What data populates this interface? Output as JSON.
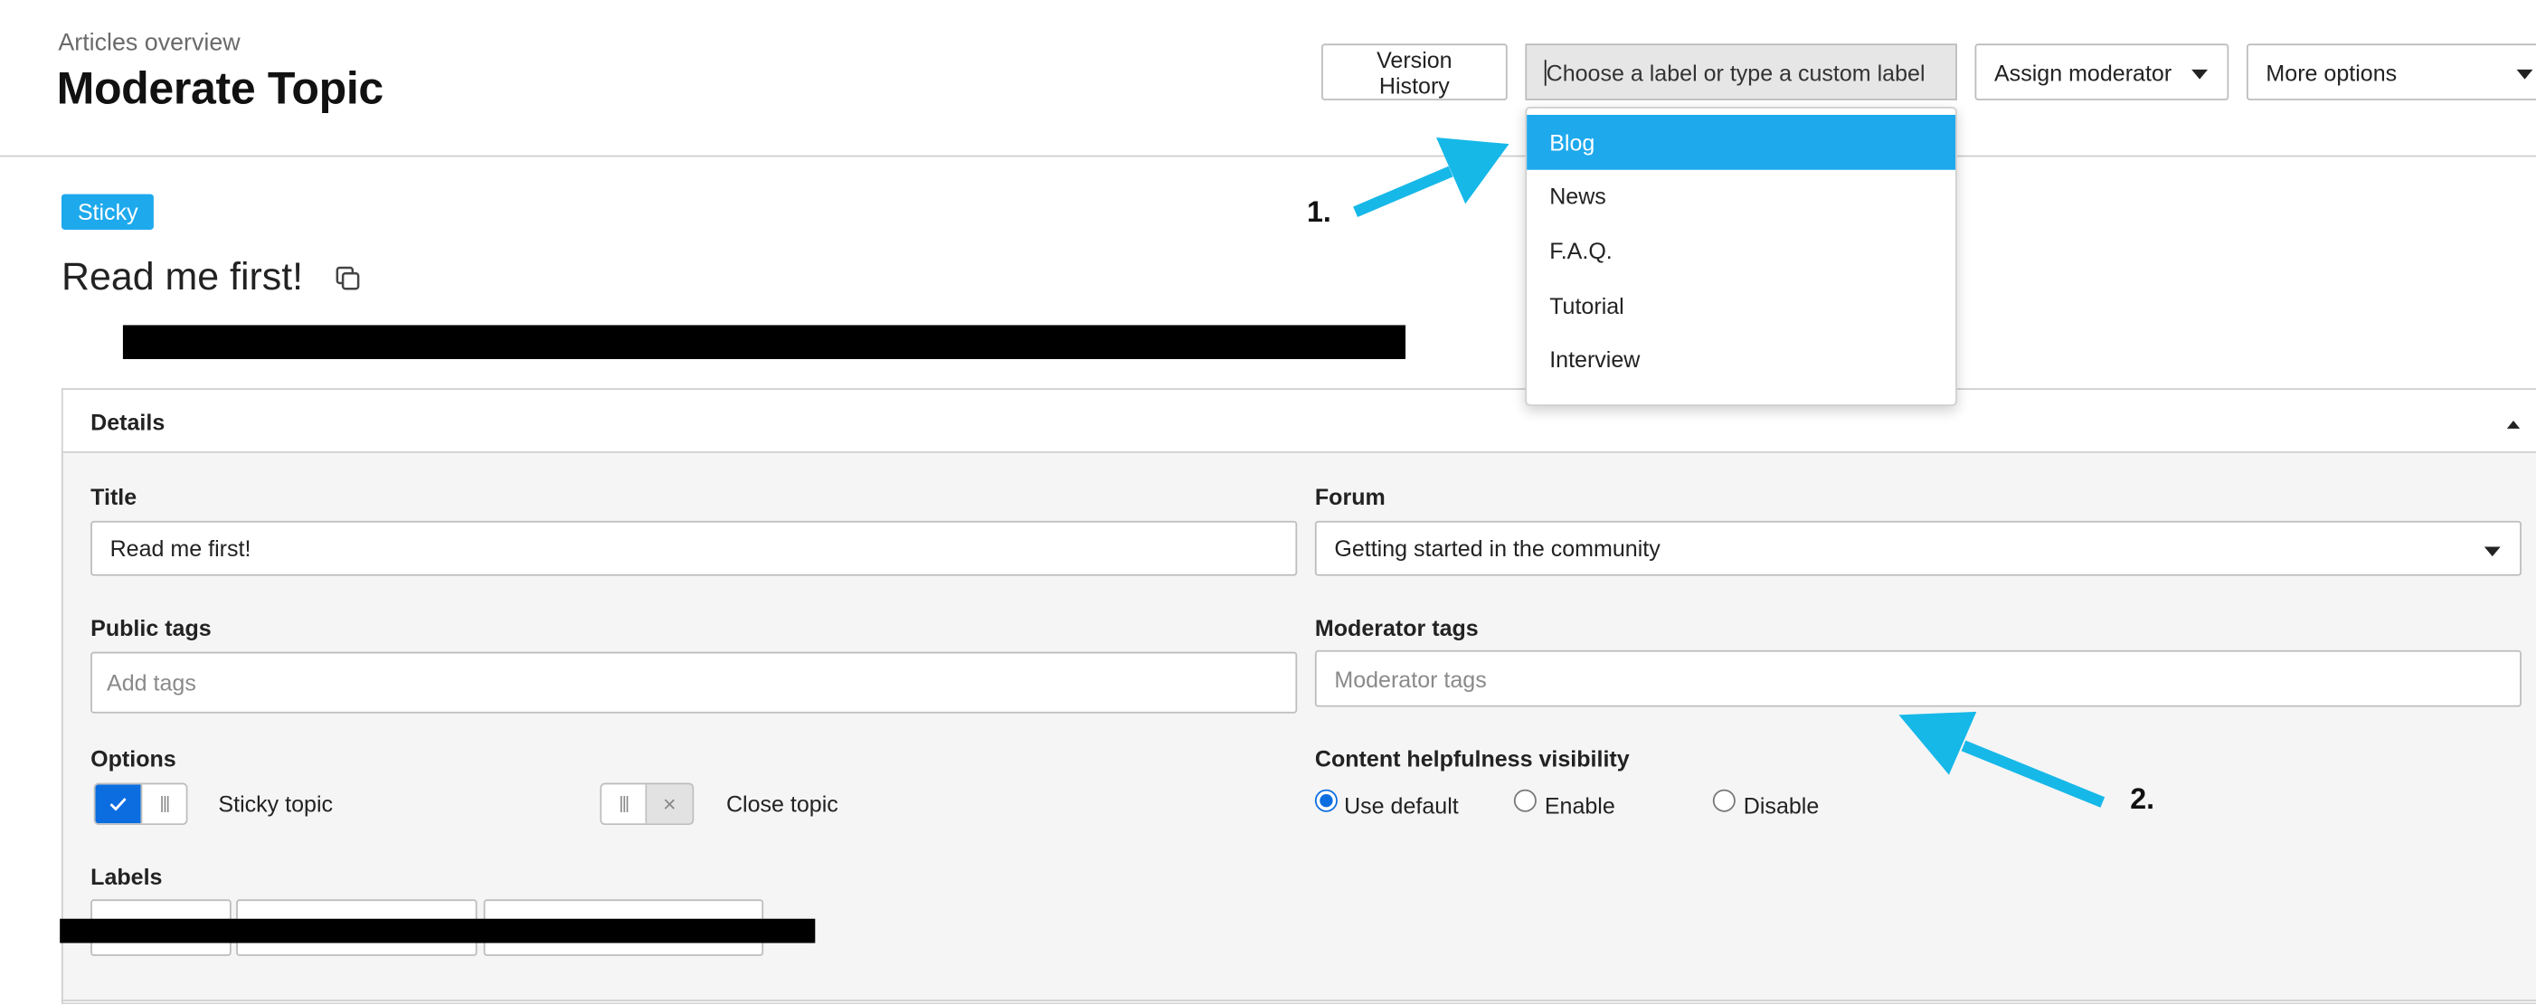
{
  "header": {
    "breadcrumb": "Articles overview",
    "title": "Moderate Topic",
    "version_history_label": "Version History",
    "label_input_placeholder": "Choose a label or type a custom label",
    "assign_moderator_label": "Assign moderator",
    "more_options_label": "More options"
  },
  "label_dropdown": {
    "options": [
      "Blog",
      "News",
      "F.A.Q.",
      "Tutorial",
      "Interview"
    ],
    "highlighted": "Blog"
  },
  "topic": {
    "badge": "Sticky",
    "title": "Read me first!"
  },
  "details": {
    "heading": "Details",
    "title_label": "Title",
    "title_value": "Read me first!",
    "forum_label": "Forum",
    "forum_value": "Getting started in the community",
    "public_tags_label": "Public tags",
    "public_tags_placeholder": "Add tags",
    "moderator_tags_label": "Moderator tags",
    "moderator_tags_placeholder": "Moderator tags",
    "options_label": "Options",
    "sticky_topic_label": "Sticky topic",
    "close_topic_label": "Close topic",
    "helpfulness_label": "Content helpfulness visibility",
    "helpfulness_options": [
      "Use default",
      "Enable",
      "Disable"
    ],
    "helpfulness_selected": "Use default",
    "labels_label": "Labels"
  },
  "annotations": {
    "step1": "1.",
    "step2": "2."
  },
  "colors": {
    "accent": "#1ea9ed",
    "toggle_on": "#0b6de0",
    "arrow": "#16b8e8"
  }
}
